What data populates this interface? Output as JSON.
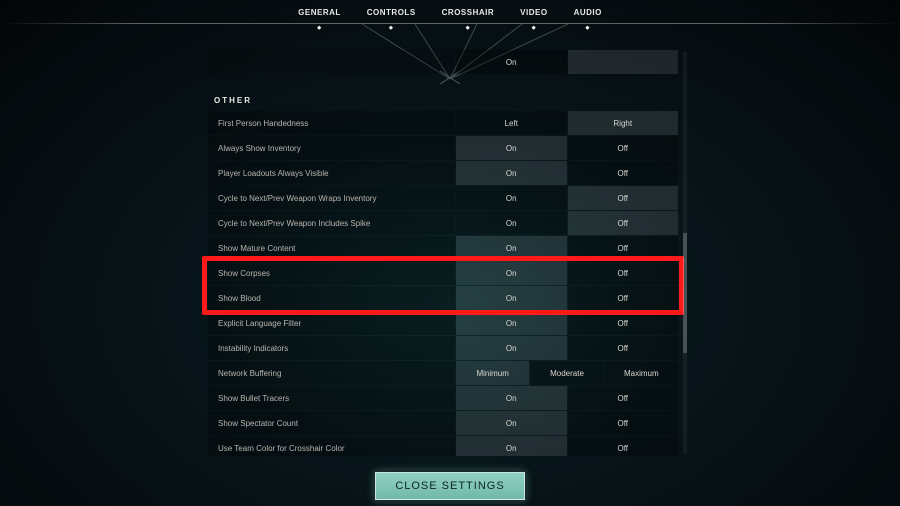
{
  "nav": {
    "items": [
      "GENERAL",
      "CONTROLS",
      "CROSSHAIR",
      "VIDEO",
      "AUDIO"
    ],
    "active": "GENERAL"
  },
  "orphan_row": {
    "label": "",
    "options": [
      "On",
      ""
    ]
  },
  "section_other": {
    "title": "OTHER",
    "rows": [
      {
        "label": "First Person Handedness",
        "options": [
          "Left",
          "Right"
        ],
        "selected": 1
      },
      {
        "label": "Always Show Inventory",
        "options": [
          "On",
          "Off"
        ],
        "selected": 0
      },
      {
        "label": "Player Loadouts Always Visible",
        "options": [
          "On",
          "Off"
        ],
        "selected": 0
      },
      {
        "label": "Cycle to Next/Prev Weapon Wraps Inventory",
        "options": [
          "On",
          "Off"
        ],
        "selected": 1
      },
      {
        "label": "Cycle to Next/Prev Weapon Includes Spike",
        "options": [
          "On",
          "Off"
        ],
        "selected": 1
      },
      {
        "label": "Show Mature Content",
        "options": [
          "On",
          "Off"
        ],
        "selected": 0
      },
      {
        "label": "Show Corpses",
        "options": [
          "On",
          "Off"
        ],
        "selected": 0
      },
      {
        "label": "Show Blood",
        "options": [
          "On",
          "Off"
        ],
        "selected": 0
      },
      {
        "label": "Explicit Language Filter",
        "options": [
          "On",
          "Off"
        ],
        "selected": 0
      },
      {
        "label": "Instability Indicators",
        "options": [
          "On",
          "Off"
        ],
        "selected": 0
      },
      {
        "label": "Network Buffering",
        "options": [
          "Minimum",
          "Moderate",
          "Maximum"
        ],
        "selected": 0
      },
      {
        "label": "Show Bullet Tracers",
        "options": [
          "On",
          "Off"
        ],
        "selected": 0
      },
      {
        "label": "Show Spectator Count",
        "options": [
          "On",
          "Off"
        ],
        "selected": 0
      },
      {
        "label": "Use Team Color for Crosshair Color",
        "options": [
          "On",
          "Off"
        ],
        "selected": 0
      }
    ]
  },
  "highlight_rows": [
    6,
    7
  ],
  "close_label": "CLOSE SETTINGS"
}
